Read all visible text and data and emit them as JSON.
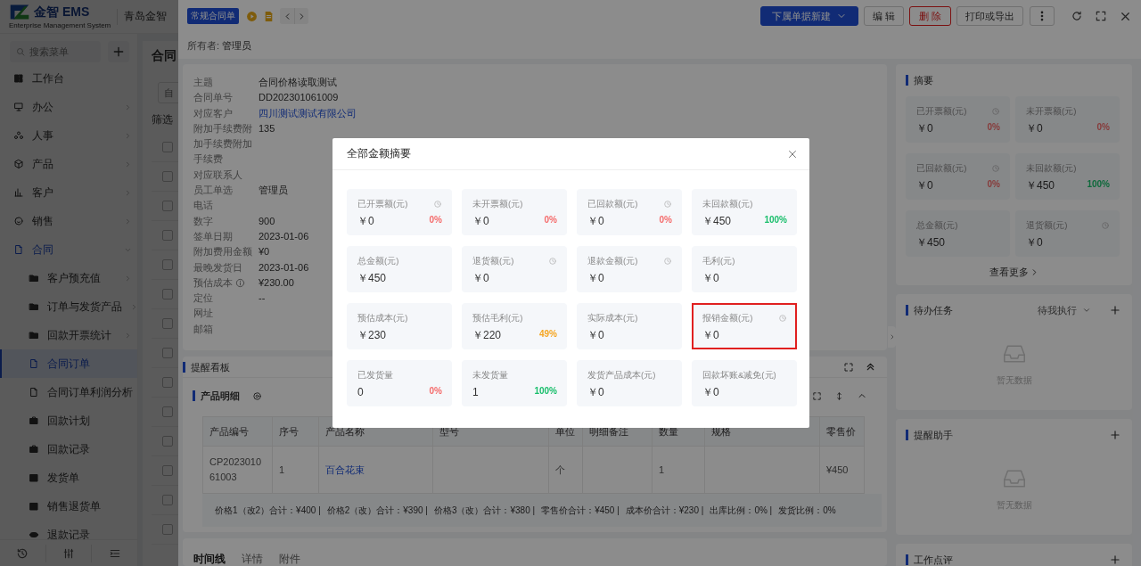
{
  "header": {
    "logo_text": "金智 EMS",
    "logo_subtitle": "Enterprise Management System",
    "company": "青岛金智"
  },
  "sidebar": {
    "search": {
      "placeholder": "搜索菜单"
    },
    "items": [
      {
        "label": "工作台",
        "selected": false
      },
      {
        "label": "办公",
        "selected": false,
        "expanded": false
      },
      {
        "label": "人事",
        "selected": false,
        "expanded": false
      },
      {
        "label": "产品",
        "selected": false,
        "expanded": false
      },
      {
        "label": "客户",
        "selected": false,
        "expanded": false
      },
      {
        "label": "销售",
        "selected": false,
        "expanded": false
      },
      {
        "label": "合同",
        "selected": false,
        "expanded": true,
        "children": [
          {
            "label": "客户预充值",
            "selected": false,
            "expanded": false
          },
          {
            "label": "订单与发货产品",
            "selected": false,
            "expanded": false
          },
          {
            "label": "回款开票统计",
            "selected": false,
            "expanded": false
          },
          {
            "label": "合同订单",
            "selected": true
          },
          {
            "label": "合同订单利润分析",
            "selected": false
          },
          {
            "label": "回款计划",
            "selected": false
          },
          {
            "label": "回款记录",
            "selected": false
          },
          {
            "label": "发货单",
            "selected": false
          },
          {
            "label": "销售退货单",
            "selected": false
          },
          {
            "label": "退款记录",
            "selected": false
          }
        ]
      }
    ]
  },
  "list_page": {
    "title": "合同",
    "field": {
      "placeholder": "自"
    },
    "filter_label": "筛选",
    "rows": [
      {
        "checked": false
      },
      {
        "checked": false
      },
      {
        "checked": false
      },
      {
        "checked": false
      },
      {
        "checked": false
      },
      {
        "checked": false
      },
      {
        "checked": false
      },
      {
        "checked": false
      },
      {
        "checked": false
      },
      {
        "checked": false
      },
      {
        "checked": false
      },
      {
        "checked": false
      },
      {
        "checked": false
      },
      {
        "checked": false
      }
    ]
  },
  "drawer": {
    "tag": "常规合同单",
    "actions": [
      {
        "label": "下属单据新建",
        "kind": "primary"
      },
      {
        "label": "编 辑",
        "kind": "default"
      },
      {
        "label": "删 除",
        "kind": "danger"
      },
      {
        "label": "打印或导出",
        "kind": "default"
      },
      {
        "kind": "more"
      }
    ],
    "owner": {
      "label": "所有者:",
      "value": "管理员"
    },
    "details": [
      {
        "label": "主题",
        "value": "合同价格读取测试"
      },
      {
        "label": "合同单号",
        "value": "DD202301061009"
      },
      {
        "label": "对应客户",
        "value": "四川测试测试有限公司",
        "kind": "link"
      },
      {
        "label": "附加手续费附加手续费附加手续费",
        "value": "135"
      },
      {
        "label": "对应联系人"
      },
      {
        "label": "员工单选",
        "value": "管理员"
      },
      {
        "label": "电话"
      },
      {
        "label": "数字",
        "value": "900"
      },
      {
        "label": "签单日期",
        "value": "2023-01-06"
      },
      {
        "label": "附加费用金额",
        "value": "¥0"
      },
      {
        "label": "最晚发货日",
        "value": "2023-01-06"
      },
      {
        "label": "预估成本",
        "value": "¥230.00",
        "info_icon": true
      },
      {
        "label": "定位",
        "value": "--"
      },
      {
        "label": "网址"
      },
      {
        "label": "邮箱"
      }
    ],
    "reminder_board": {
      "title": "提醒看板",
      "product_detail": {
        "title": "产品明细",
        "table": {
          "columns": [
            "产品编号",
            "序号",
            "产品名称",
            "型号",
            "单位",
            "明细备注",
            "数量",
            "规格",
            "零售价"
          ],
          "rows": [
            {
              "cells": [
                "CP202301061003",
                "1",
                {
                  "text": "百合花束",
                  "kind": "link"
                },
                null,
                "个",
                null,
                "1",
                null,
                "¥450"
              ]
            }
          ]
        },
        "totals": [
          "价格1（改2）合计：¥400 |",
          "价格2（改）合计：¥390 |",
          "价格3（改）合计：¥380 |",
          "零售价合计：¥450 |",
          "成本价合计：¥230 |",
          "出库比例：0% |",
          "发货比例：0%"
        ]
      }
    },
    "bottom_tabs": [
      {
        "label": "时间线",
        "selected": true
      },
      {
        "label": "详情",
        "selected": false
      },
      {
        "label": "附件",
        "selected": false
      }
    ],
    "summary": {
      "title": "摘要",
      "tiles": [
        {
          "label": "已开票额(元)",
          "value": "￥0",
          "clock_icon": true,
          "percent": "0%",
          "color": "#873b3b"
        },
        {
          "label": "未开票额(元)",
          "value": "￥0",
          "clock_icon": false,
          "percent": "0%",
          "color": "#873b3b"
        },
        {
          "label": "已回款额(元)",
          "value": "￥0",
          "clock_icon": true,
          "percent": "0%",
          "color": "#873b3b"
        },
        {
          "label": "未回款额(元)",
          "value": "￥450",
          "clock_icon": false,
          "percent": "100%",
          "color": "#0e693b"
        },
        {
          "label": "总金额(元)",
          "value": "￥450",
          "clock_icon": false
        },
        {
          "label": "退货额(元)",
          "value": "￥0",
          "clock_icon": true
        }
      ],
      "more_link": "查看更多"
    },
    "tasks": {
      "title": "待办任务",
      "filter": "待我执行",
      "empty_text": "暂无数据"
    },
    "assistant": {
      "title": "提醒助手",
      "empty_text": "暂无数据"
    },
    "review": {
      "title": "工作点评"
    }
  },
  "modal": {
    "title": "全部金额摘要",
    "tiles": [
      {
        "label": "已开票额(元)",
        "value": "￥0",
        "clock_icon": true,
        "percent": "0%",
        "color": "#f56c6c",
        "highlighted": false
      },
      {
        "label": "未开票额(元)",
        "value": "￥0",
        "clock_icon": false,
        "percent": "0%",
        "color": "#f56c6c",
        "highlighted": false
      },
      {
        "label": "已回款额(元)",
        "value": "￥0",
        "clock_icon": true,
        "percent": "0%",
        "color": "#f56c6c",
        "highlighted": false
      },
      {
        "label": "未回款额(元)",
        "value": "￥450",
        "clock_icon": false,
        "percent": "100%",
        "color": "#19be6b",
        "highlighted": false
      },
      {
        "label": "总金额(元)",
        "value": "￥450",
        "clock_icon": false,
        "highlighted": false
      },
      {
        "label": "退货额(元)",
        "value": "￥0",
        "clock_icon": true,
        "highlighted": false
      },
      {
        "label": "退款金额(元)",
        "value": "￥0",
        "clock_icon": true,
        "highlighted": false
      },
      {
        "label": "毛利(元)",
        "value": "￥0",
        "clock_icon": false,
        "highlighted": false
      },
      {
        "label": "预估成本(元)",
        "value": "￥230",
        "clock_icon": false,
        "highlighted": false
      },
      {
        "label": "预估毛利(元)",
        "value": "￥220",
        "clock_icon": false,
        "percent": "49%",
        "color": "#f5a623",
        "highlighted": false
      },
      {
        "label": "实际成本(元)",
        "value": "￥0",
        "clock_icon": false,
        "highlighted": false
      },
      {
        "label": "报销金额(元)",
        "value": "￥0",
        "clock_icon": true,
        "highlighted": true
      },
      {
        "label": "已发货量",
        "value": "0",
        "clock_icon": false,
        "percent": "0%",
        "color": "#f56c6c",
        "highlighted": false
      },
      {
        "label": "未发货量",
        "value": "1",
        "clock_icon": false,
        "percent": "100%",
        "color": "#19be6b",
        "highlighted": false
      },
      {
        "label": "发货产品成本(元)",
        "value": "￥0",
        "clock_icon": false,
        "highlighted": false
      },
      {
        "label": "回款坏账&减免(元)",
        "value": "￥0",
        "clock_icon": false,
        "highlighted": false
      }
    ]
  }
}
